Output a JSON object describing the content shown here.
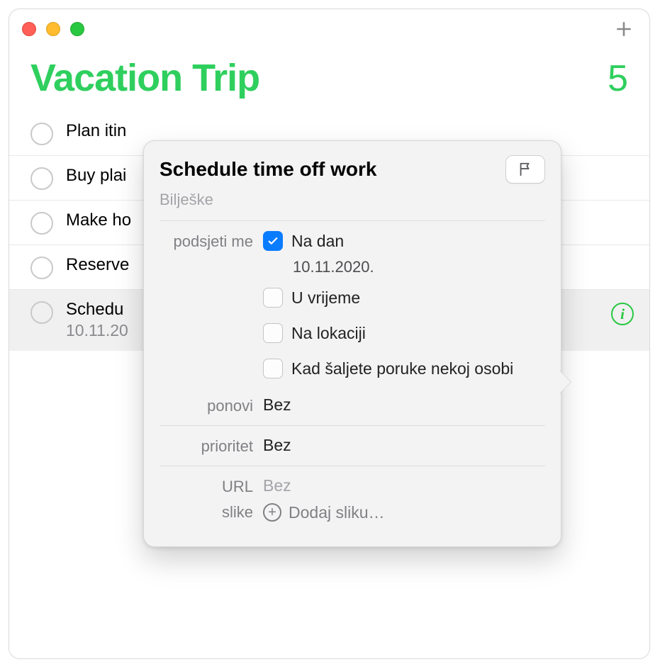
{
  "accent": "#2fcf5e",
  "header": {
    "title": "Vacation Trip",
    "count": "5"
  },
  "items": [
    {
      "title": "Plan itin"
    },
    {
      "title": "Buy plai"
    },
    {
      "title": "Make ho"
    },
    {
      "title": "Reserve"
    },
    {
      "title": "Schedu",
      "sub": "10.11.20",
      "selected": true
    }
  ],
  "popover": {
    "title": "Schedule time off work",
    "notes_placeholder": "Bilješke",
    "remind_label": "podsjeti me",
    "options": {
      "on_day": {
        "label": "Na dan",
        "checked": true,
        "date": "10.11.2020."
      },
      "at_time": {
        "label": "U vrijeme",
        "checked": false
      },
      "at_location": {
        "label": "Na lokaciji",
        "checked": false
      },
      "when_messaging": {
        "label": "Kad šaljete poruke nekoj osobi",
        "checked": false
      }
    },
    "repeat_label": "ponovi",
    "repeat_value": "Bez",
    "priority_label": "prioritet",
    "priority_value": "Bez",
    "url_label": "URL",
    "url_value": "Bez",
    "images_label": "slike",
    "add_image": "Dodaj sliku…"
  }
}
